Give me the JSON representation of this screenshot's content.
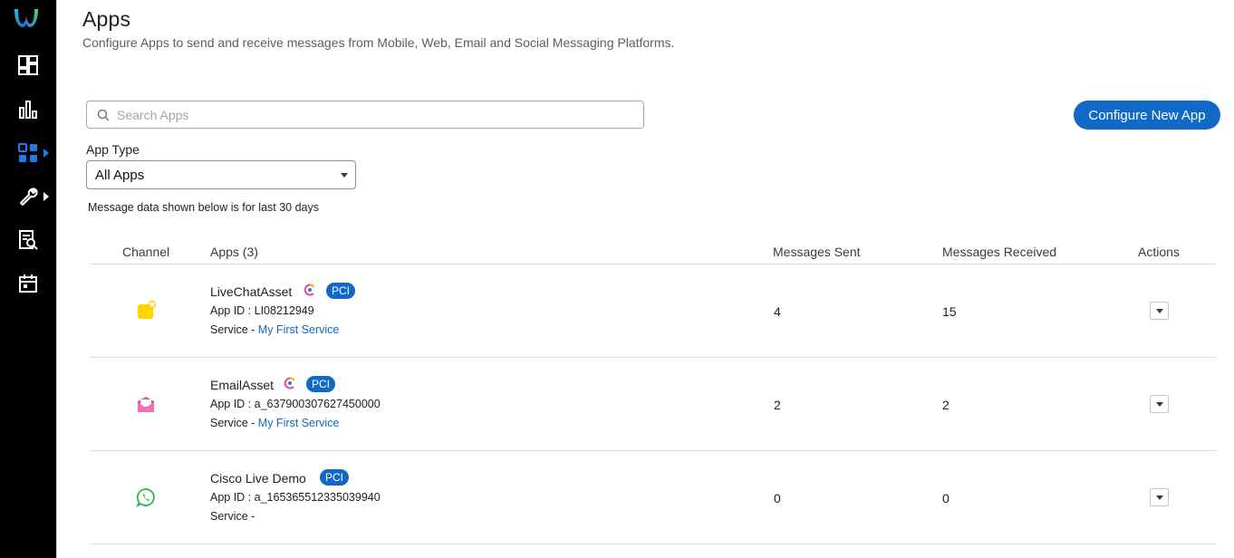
{
  "colors": {
    "accent": "#1068c7",
    "sidebar_bg": "#000000",
    "active_icon": "#1f7be6"
  },
  "sidebar": {
    "items": [
      {
        "name": "dashboard-icon"
      },
      {
        "name": "analytics-icon"
      },
      {
        "name": "apps-icon",
        "active": true
      },
      {
        "name": "wrench-icon"
      },
      {
        "name": "report-icon"
      },
      {
        "name": "calendar-icon"
      }
    ]
  },
  "header": {
    "title": "Apps",
    "subtitle": "Configure Apps to send and receive messages from Mobile, Web, Email and Social Messaging Platforms."
  },
  "search": {
    "placeholder": "Search Apps",
    "value": ""
  },
  "configure_button": "Configure New App",
  "app_type": {
    "label": "App Type",
    "selected": "All Apps"
  },
  "message_note": "Message data shown below is for last 30 days",
  "table": {
    "headers": {
      "channel": "Channel",
      "apps": "Apps (3)",
      "sent": "Messages Sent",
      "received": "Messages Received",
      "actions": "Actions"
    },
    "rows": [
      {
        "channel_icon": "livechat-icon",
        "name": "LiveChatAsset",
        "has_c_badge": true,
        "badge": "PCI",
        "app_id": "App ID : LI08212949",
        "service_prefix": "Service - ",
        "service_link": "My First Service",
        "sent": "4",
        "received": "15"
      },
      {
        "channel_icon": "email-icon",
        "name": "EmailAsset",
        "has_c_badge": true,
        "badge": "PCI",
        "app_id": "App ID : a_637900307627450000",
        "service_prefix": "Service - ",
        "service_link": "My First Service",
        "sent": "2",
        "received": "2"
      },
      {
        "channel_icon": "whatsapp-icon",
        "name": "Cisco Live Demo",
        "has_c_badge": false,
        "badge": "PCI",
        "app_id": "App ID : a_165365512335039940",
        "service_prefix": "Service -",
        "service_link": "",
        "sent": "0",
        "received": "0"
      }
    ]
  }
}
